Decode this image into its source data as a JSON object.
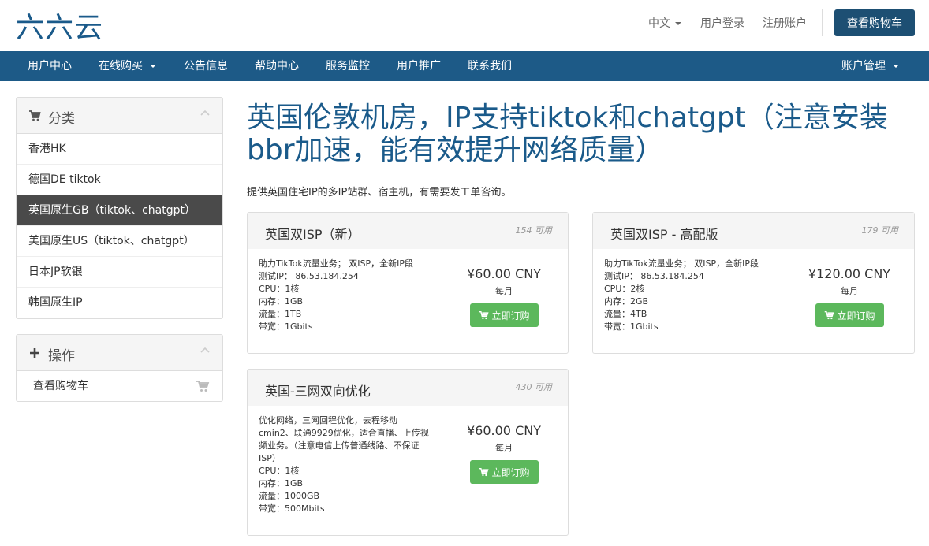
{
  "header": {
    "logo": "六六云",
    "language": "中文",
    "login": "用户登录",
    "register": "注册账户",
    "view_cart": "查看购物车"
  },
  "nav": {
    "items": [
      "用户中心",
      "在线购买",
      "公告信息",
      "帮助中心",
      "服务监控",
      "用户推广",
      "联系我们"
    ],
    "account": "账户管理"
  },
  "sidebar": {
    "categories_title": "分类",
    "categories": [
      "香港HK",
      "德国DE tiktok",
      "英国原生GB（tiktok、chatgpt）",
      "美国原生US（tiktok、chatgpt）",
      "日本JP软银",
      "韩国原生IP"
    ],
    "active_index": 2,
    "actions_title": "操作",
    "actions": [
      "查看购物车"
    ]
  },
  "main": {
    "title": "英国伦敦机房，IP支持tiktok和chatgpt（注意安装bbr加速，能有效提升网络质量）",
    "subtitle": "提供英国住宅IP的多IP站群、宿主机，有需要发工单咨询。",
    "products": [
      {
        "name": "英国双ISP（新）",
        "available": "154 可用",
        "desc": [
          "助力TikTok流量业务； 双ISP，全新IP段",
          "测试IP：  86.53.184.254",
          "CPU：1核",
          "内存：1GB",
          "流量：1TB",
          "带宽：1Gbits"
        ],
        "price": "¥60.00 CNY",
        "cycle": "每月",
        "order": "立即订购"
      },
      {
        "name": "英国双ISP - 高配版",
        "available": "179 可用",
        "desc": [
          "助力TikTok流量业务； 双ISP，全新IP段",
          "测试IP：  86.53.184.254",
          "CPU：2核",
          "内存：2GB",
          "流量：4TB",
          "带宽：1Gbits"
        ],
        "price": "¥120.00 CNY",
        "cycle": "每月",
        "order": "立即订购"
      },
      {
        "name": "英国-三网双向优化",
        "available": "430 可用",
        "desc": [
          "优化网络，三网回程优化，去程移动",
          "cmin2、联通9929优化，适合直播、上传视",
          "频业务。（注意电信上传普通线路、不保证",
          "ISP）",
          "CPU：1核",
          "内存：1GB",
          "流量：1000GB",
          "带宽：500Mbits"
        ],
        "price": "¥60.00 CNY",
        "cycle": "每月",
        "order": "立即订购"
      }
    ]
  },
  "colors": {
    "brand": "#1a5a8a",
    "nav_bg": "#1d5a87",
    "active_item": "#4a4a4a",
    "order_button": "#5cb85c"
  }
}
